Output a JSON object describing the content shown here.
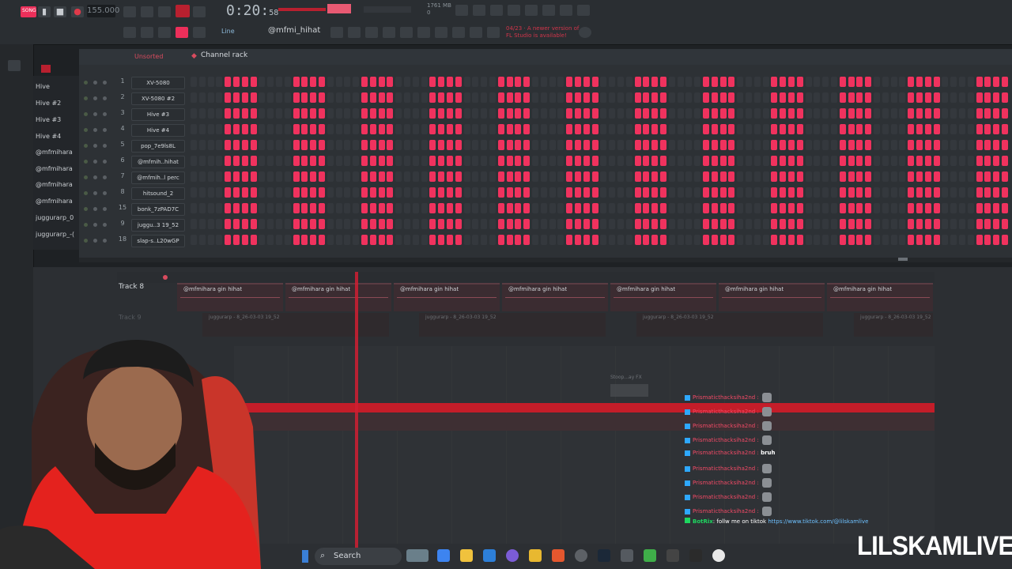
{
  "toolbar": {
    "mode_label": "SONG",
    "tempo": "155.000",
    "song_time": "0:20",
    "song_time_sub": "58",
    "memory": "1761 MB",
    "memory_num": "0",
    "pattern_name": "@mfmi_hihat",
    "line_mode": "Line",
    "update_notice": "04/23 · A newer version of FL Studio is available!"
  },
  "browser": {
    "items": [
      "Hive",
      "Hive #2",
      "Hive #3",
      "Hive #4",
      "@mfmihara",
      "@mfmihara",
      "@mfmihara",
      "@mfmihara",
      "juggurarp_0",
      "juggurarp_-("
    ]
  },
  "rack": {
    "sort_label": "Unsorted",
    "title": "Channel rack",
    "channels": [
      {
        "num": "1",
        "name": "XV-5080"
      },
      {
        "num": "2",
        "name": "XV-5080 #2"
      },
      {
        "num": "3",
        "name": "Hive #3"
      },
      {
        "num": "4",
        "name": "Hive #4"
      },
      {
        "num": "5",
        "name": "pop_7e9ls8L"
      },
      {
        "num": "6",
        "name": "@mfmih..hihat"
      },
      {
        "num": "7",
        "name": "@mfmih..l perc"
      },
      {
        "num": "8",
        "name": "hitsound_2"
      },
      {
        "num": "15",
        "name": "bonk_7zPAD7C"
      },
      {
        "num": "9",
        "name": "juggu..3 19_52"
      },
      {
        "num": "18",
        "name": "slap-s..L20wGP"
      }
    ]
  },
  "playlist": {
    "track_label": "Track 8",
    "track9_label": "Track 9",
    "clip_name": "@mfmihara gin hihat",
    "clip2_name": "juggurarp - 8_26-03-03 19_52",
    "fx_clip": "Stoop...ay FX"
  },
  "chat": {
    "lines": [
      {
        "user": "Prismaticthacksiha2nd",
        "msg": ""
      },
      {
        "user": "Prismaticthacksiha2nd",
        "msg": ""
      },
      {
        "user": "Prismaticthacksiha2nd",
        "msg": ""
      },
      {
        "user": "Prismaticthacksiha2nd",
        "msg": ""
      },
      {
        "user": "Prismaticthacksiha2nd",
        "msg": "bruh"
      },
      {
        "user": "Prismaticthacksiha2nd",
        "msg": ""
      },
      {
        "user": "Prismaticthacksiha2nd",
        "msg": ""
      },
      {
        "user": "Prismaticthacksiha2nd",
        "msg": ""
      },
      {
        "user": "Prismaticthacksiha2nd",
        "msg": ""
      }
    ],
    "bot_name": "BotRix",
    "bot_message": ": follw me on tiktok",
    "bot_link": "https://www.tiktok.com/@lilskamlive"
  },
  "taskbar": {
    "search_label": "Search"
  },
  "watermark": "LILSKAMLIVE",
  "colors": {
    "accent": "#f0325e",
    "background": "#2d3135",
    "automation": "#c41d29"
  }
}
